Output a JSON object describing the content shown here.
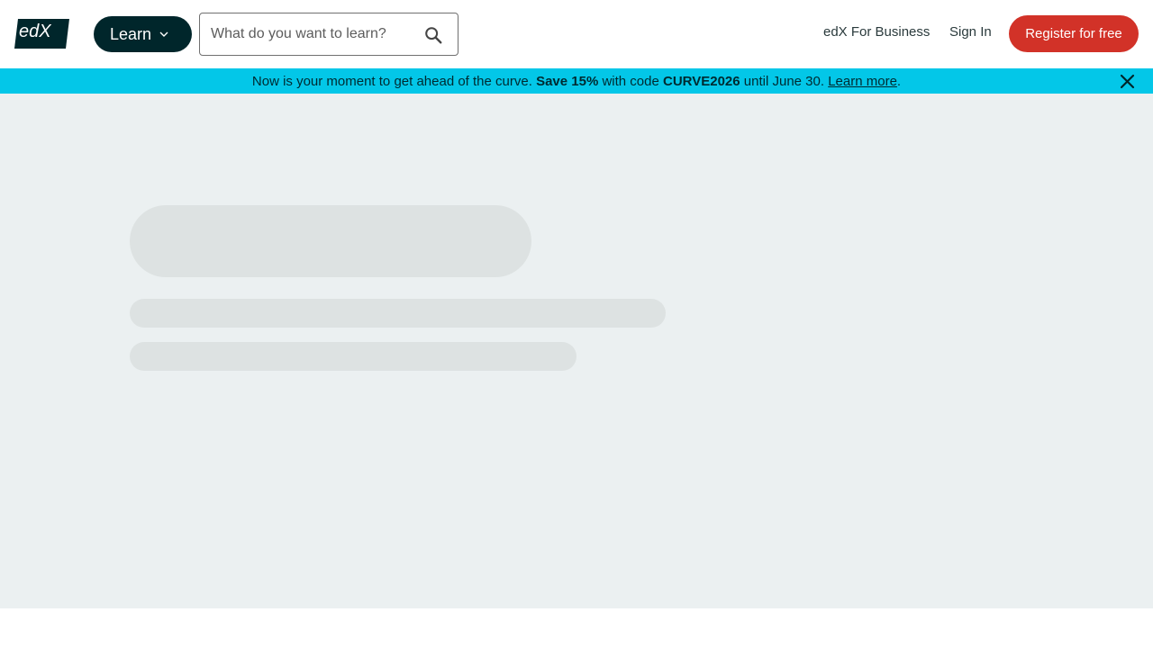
{
  "header": {
    "logo_text": "edX",
    "learn_label": "Learn",
    "search_placeholder": "What do you want to learn?",
    "business_link": "edX For Business",
    "signin_link": "Sign In",
    "register_label": "Register for free"
  },
  "banner": {
    "text_1": "Now is your moment to get ahead of the curve. ",
    "bold_1": "Save 15%",
    "text_2": " with code ",
    "bold_2": "CURVE2026",
    "text_3": " until June 30. ",
    "link": "Learn more",
    "text_4": "."
  },
  "colors": {
    "brand_dark": "#00262b",
    "accent_red": "#d23228",
    "banner_cyan": "#03c7e8",
    "main_bg": "#ebf0f1",
    "skeleton": "#dde2e2"
  }
}
